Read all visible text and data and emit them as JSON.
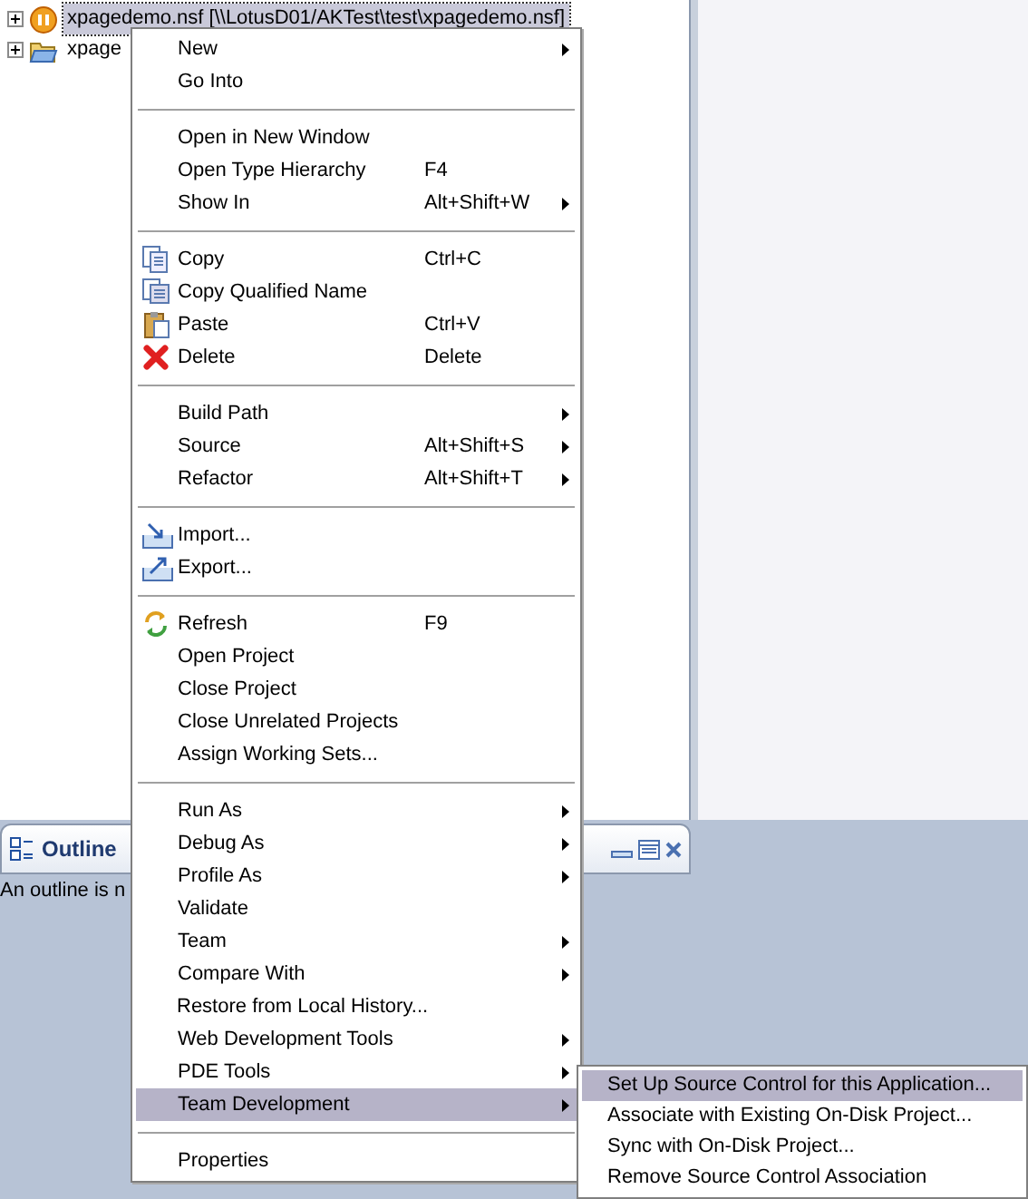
{
  "tree": [
    {
      "label": "xpagedemo.nsf [\\\\LotusD01/AKTest\\test\\xpagedemo.nsf]",
      "kind": "database",
      "selected": true
    },
    {
      "label": "xpage",
      "kind": "folder",
      "selected": false
    }
  ],
  "outline": {
    "title": "Outline",
    "message": "An outline is n"
  },
  "context_menu": [
    {
      "kind": "plain",
      "label": "New",
      "submenu": true,
      "selected": false
    },
    {
      "kind": "plain",
      "label": "Go Into",
      "submenu": false,
      "selected": false
    },
    {
      "kind": "separator"
    },
    {
      "kind": "plain",
      "label": "Open in New Window",
      "submenu": false,
      "selected": false
    },
    {
      "kind": "plain",
      "label": "Open Type Hierarchy",
      "shortcut": "F4",
      "submenu": false,
      "selected": false
    },
    {
      "kind": "plain",
      "label": "Show In",
      "shortcut": "Alt+Shift+W",
      "submenu": true,
      "selected": false
    },
    {
      "kind": "separator"
    },
    {
      "kind": "copy",
      "label": "Copy",
      "shortcut": "Ctrl+C",
      "submenu": false,
      "selected": false
    },
    {
      "kind": "copyname",
      "label": "Copy Qualified Name",
      "submenu": false,
      "selected": false
    },
    {
      "kind": "paste",
      "label": "Paste",
      "shortcut": "Ctrl+V",
      "submenu": false,
      "selected": false
    },
    {
      "kind": "delete",
      "label": "Delete",
      "shortcut": "Delete",
      "submenu": false,
      "selected": false
    },
    {
      "kind": "separator"
    },
    {
      "kind": "plain",
      "label": "Build Path",
      "submenu": true,
      "selected": false
    },
    {
      "kind": "plain",
      "label": "Source",
      "shortcut": "Alt+Shift+S",
      "submenu": true,
      "selected": false
    },
    {
      "kind": "plain",
      "label": "Refactor",
      "shortcut": "Alt+Shift+T",
      "submenu": true,
      "selected": false
    },
    {
      "kind": "separator"
    },
    {
      "kind": "import",
      "label": "Import...",
      "submenu": false,
      "selected": false
    },
    {
      "kind": "export",
      "label": "Export...",
      "submenu": false,
      "selected": false
    },
    {
      "kind": "separator"
    },
    {
      "kind": "refresh",
      "label": "Refresh",
      "shortcut": "F9",
      "submenu": false,
      "selected": false
    },
    {
      "kind": "plain",
      "label": "Open Project",
      "submenu": false,
      "selected": false
    },
    {
      "kind": "plain",
      "label": "Close Project",
      "submenu": false,
      "selected": false
    },
    {
      "kind": "plain",
      "label": "Close Unrelated Projects",
      "submenu": false,
      "selected": false
    },
    {
      "kind": "plain",
      "label": "Assign Working Sets...",
      "submenu": false,
      "selected": false
    },
    {
      "kind": "separator"
    },
    {
      "kind": "plain",
      "label": "Run As",
      "submenu": true,
      "selected": false
    },
    {
      "kind": "plain",
      "label": "Debug As",
      "submenu": true,
      "selected": false
    },
    {
      "kind": "plain",
      "label": "Profile As",
      "submenu": true,
      "selected": false
    },
    {
      "kind": "plain",
      "label": "Validate",
      "submenu": false,
      "selected": false
    },
    {
      "kind": "plain",
      "label": "Team",
      "submenu": true,
      "selected": false
    },
    {
      "kind": "plain",
      "label": "Compare With",
      "submenu": true,
      "selected": false
    },
    {
      "kind": "plain",
      "label": "Restore from Local History...",
      "submenu": false,
      "selected": false
    },
    {
      "kind": "plain",
      "label": "Web Development Tools",
      "submenu": true,
      "selected": false
    },
    {
      "kind": "plain",
      "label": "PDE Tools",
      "submenu": true,
      "selected": false
    },
    {
      "kind": "plain",
      "label": "Team Development",
      "submenu": true,
      "selected": true
    },
    {
      "kind": "separator"
    },
    {
      "kind": "plain",
      "label": "Properties",
      "submenu": false,
      "selected": false
    }
  ],
  "submenu": [
    {
      "label": "Set Up Source Control for this Application...",
      "selected": true
    },
    {
      "label": "Associate with Existing On-Disk Project...",
      "selected": false
    },
    {
      "label": "Sync with On-Disk Project...",
      "selected": false
    },
    {
      "label": "Remove Source Control Association",
      "selected": false
    }
  ]
}
